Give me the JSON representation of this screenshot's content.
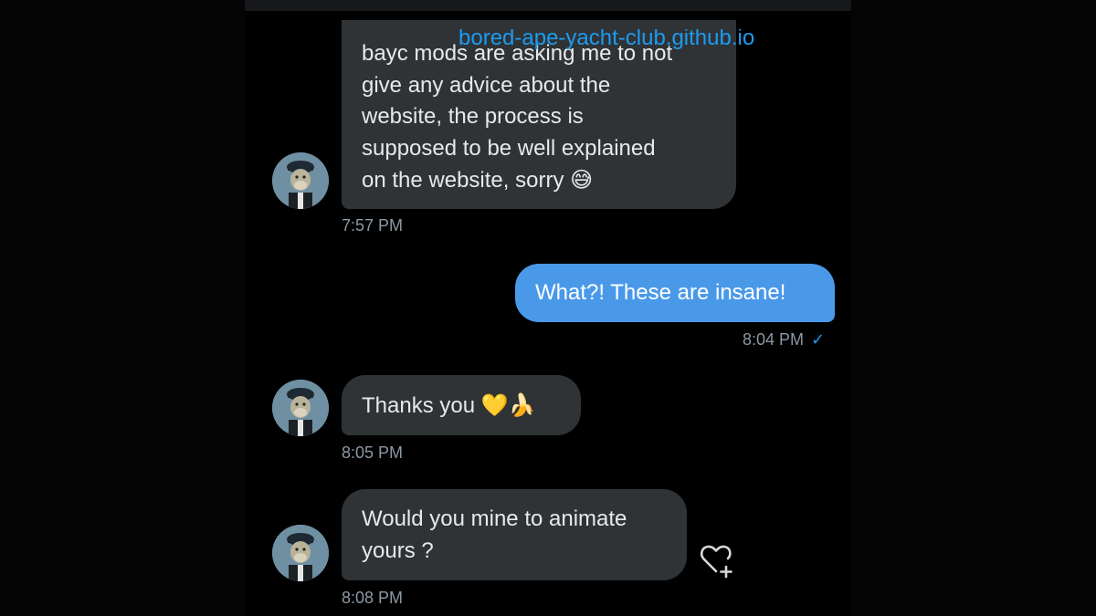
{
  "messages": [
    {
      "direction": "incoming",
      "link": "bored-ape-yacht-club.github.io",
      "text_lines": [
        "bayc mods are asking me to not",
        "give any advice about the",
        "website, the process is",
        "supposed to be well explained",
        "on the website, sorry"
      ],
      "emoji": "😅",
      "time": "7:57 PM"
    },
    {
      "direction": "outgoing",
      "text": "What?! These are insane!",
      "time": "8:04 PM",
      "status": "✓"
    },
    {
      "direction": "incoming",
      "text": "Thanks you",
      "emoji": "💛🍌",
      "time": "8:05 PM"
    },
    {
      "direction": "incoming",
      "text_lines": [
        "Would you mine to animate",
        "yours ?"
      ],
      "time": "8:08 PM"
    }
  ],
  "colors": {
    "incoming_bubble": "#2f3336",
    "outgoing_bubble": "#4a99e9",
    "accent": "#1d9bf0",
    "timestamp": "#8b98a5"
  },
  "icons": {
    "avatar": "ape-avatar-icon",
    "reaction": "heart-plus-icon"
  }
}
